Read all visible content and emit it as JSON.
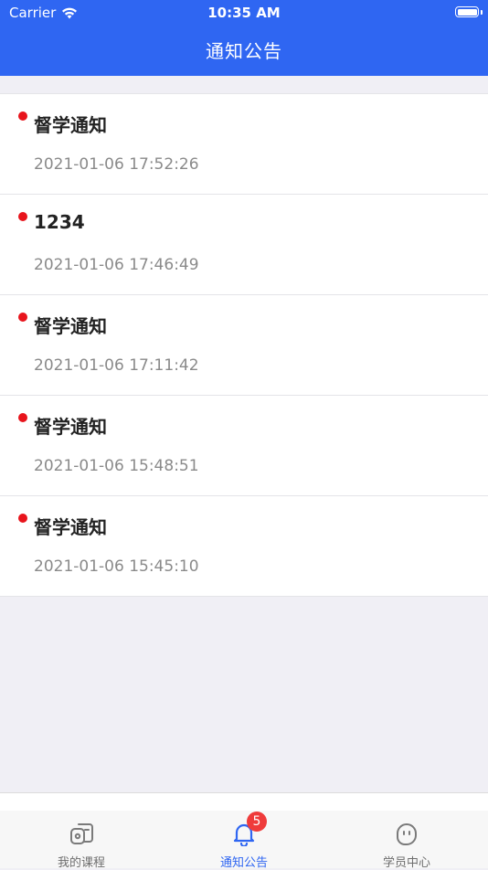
{
  "status_bar": {
    "carrier": "Carrier",
    "time": "10:35 AM"
  },
  "header": {
    "title": "通知公告"
  },
  "notices": [
    {
      "title": "督学通知",
      "time": "2021-01-06 17:52:26",
      "unread": true
    },
    {
      "title": "1234",
      "time": "2021-01-06 17:46:49",
      "unread": true
    },
    {
      "title": "督学通知",
      "time": "2021-01-06 17:11:42",
      "unread": true
    },
    {
      "title": "督学通知",
      "time": "2021-01-06 15:48:51",
      "unread": true
    },
    {
      "title": "督学通知",
      "time": "2021-01-06 15:45:10",
      "unread": true
    }
  ],
  "tab_bar": {
    "tabs": [
      {
        "label": "我的课程",
        "icon": "courses-icon",
        "active": false
      },
      {
        "label": "通知公告",
        "icon": "bell-icon",
        "active": true,
        "badge": "5"
      },
      {
        "label": "学员中心",
        "icon": "student-center-icon",
        "active": false
      }
    ]
  },
  "colors": {
    "accent": "#2f66f2",
    "unread_dot": "#e8141c",
    "badge": "#ef3b3b"
  }
}
